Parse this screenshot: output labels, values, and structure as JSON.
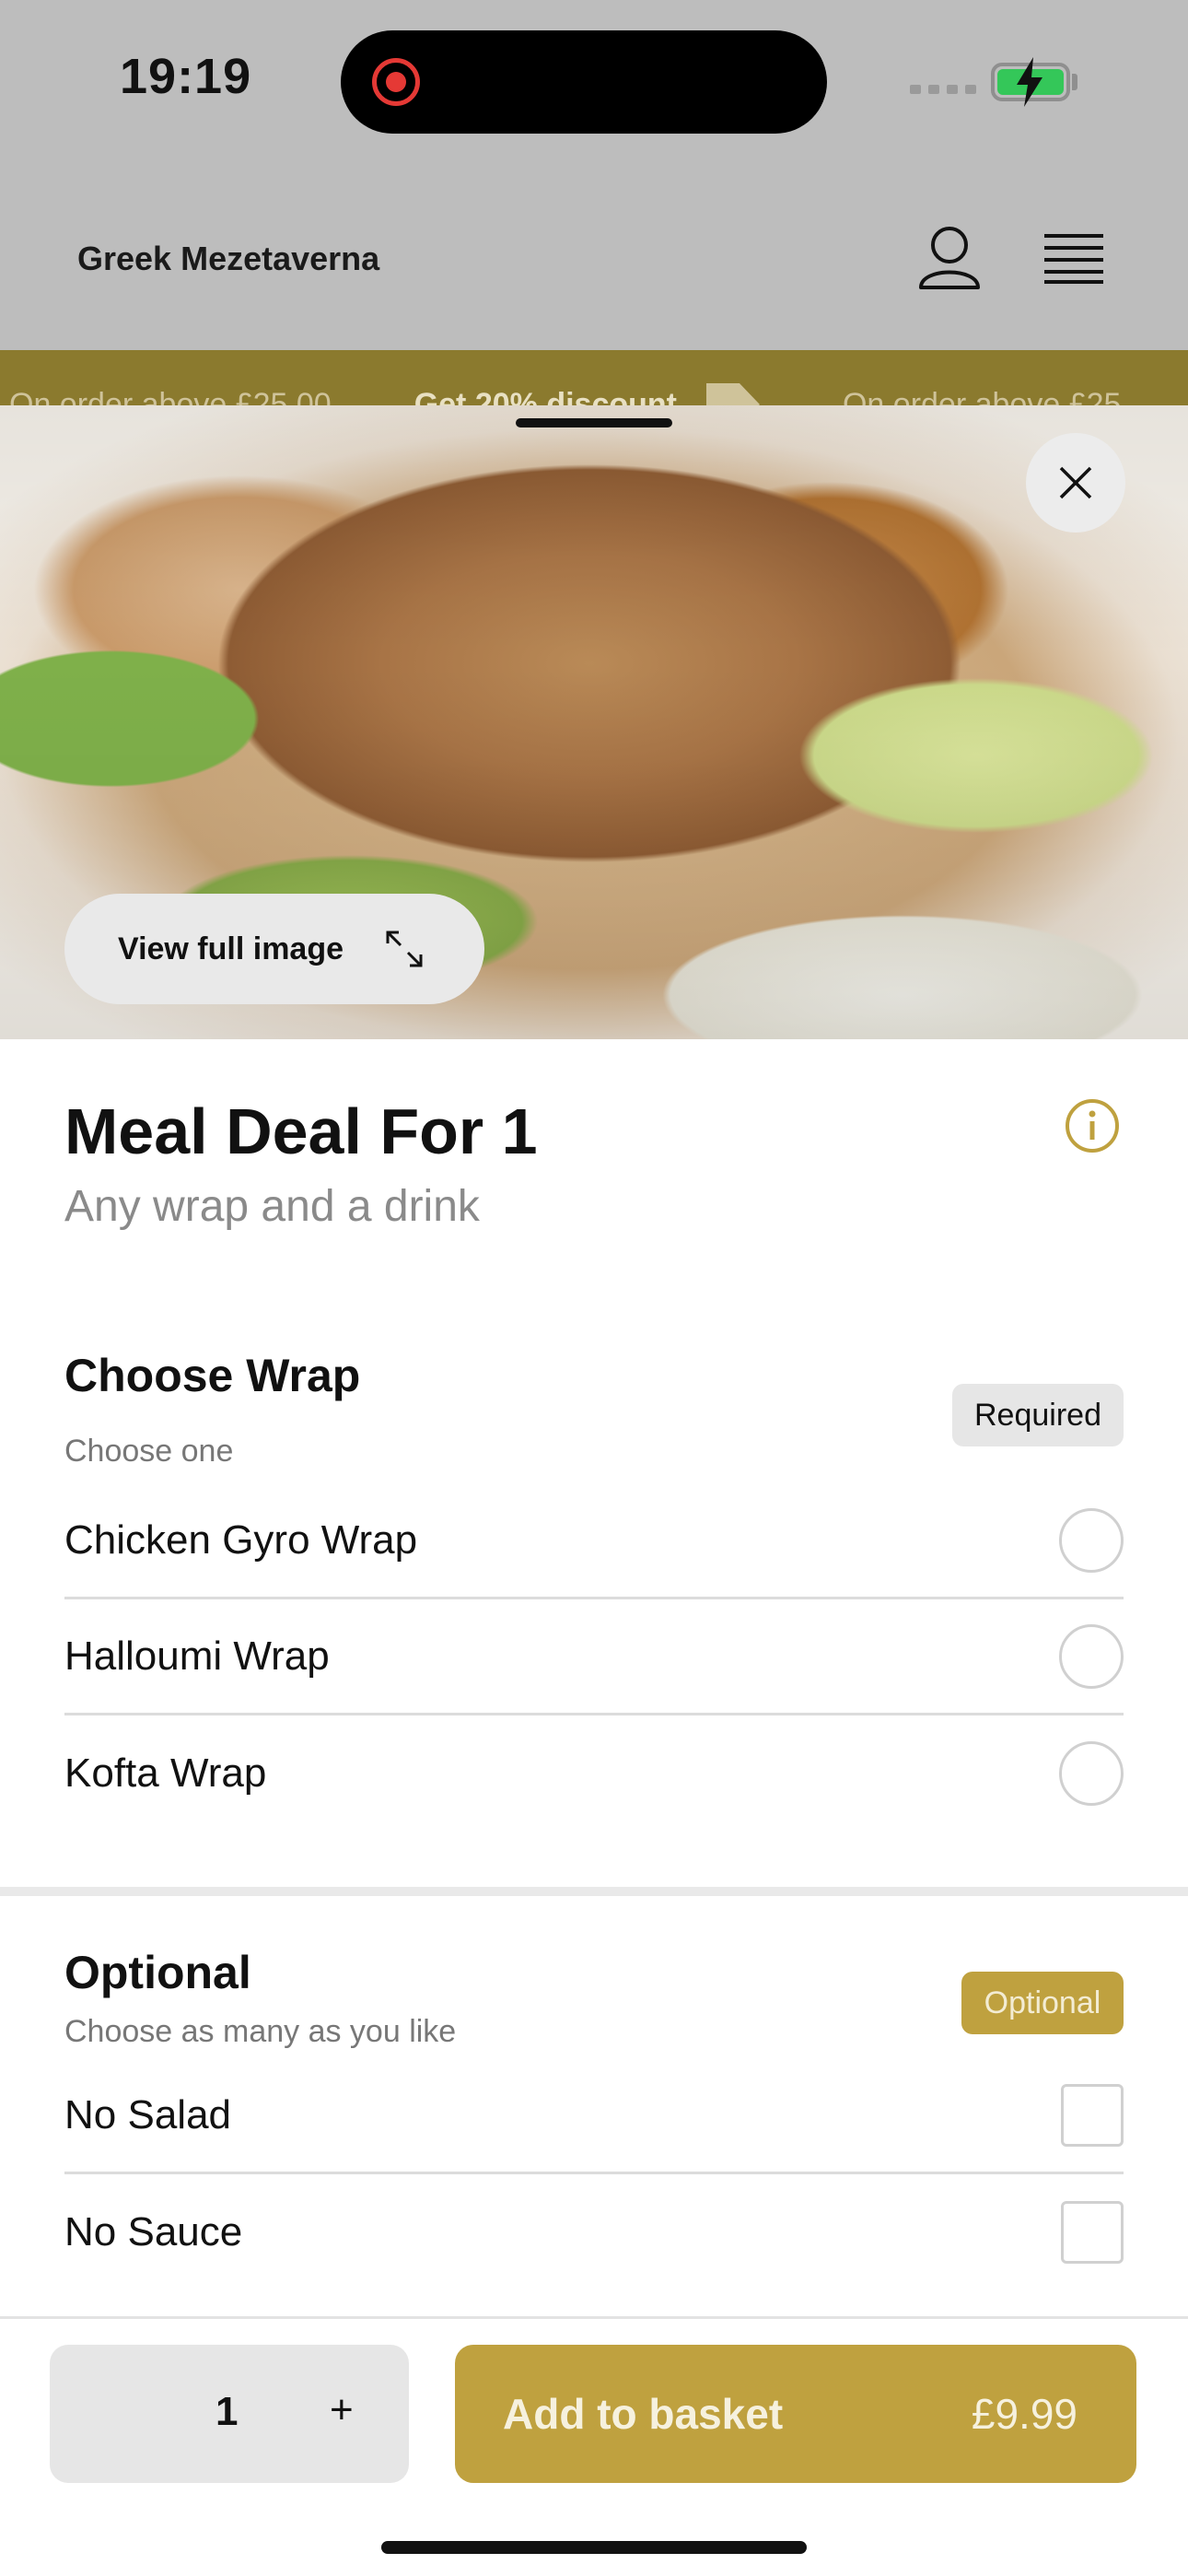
{
  "status_bar": {
    "time": "19:19",
    "icons": [
      "screen-recording-icon",
      "signal-icon",
      "battery-charging-icon"
    ]
  },
  "header": {
    "brand": "Greek Mezetaverna",
    "icons": [
      "user-icon",
      "menu-icon"
    ]
  },
  "promo": {
    "items": [
      "On order above £25.00",
      "Get 20% discount",
      "On order above £25"
    ]
  },
  "item": {
    "view_full_label": "View full image",
    "title": "Meal Deal For 1",
    "subtitle": "Any wrap and a drink"
  },
  "groups": [
    {
      "title": "Choose Wrap",
      "hint": "Choose one",
      "badge": "Required",
      "options": [
        "Chicken Gyro Wrap",
        "Halloumi Wrap",
        "Kofta Wrap"
      ]
    },
    {
      "title": "Optional",
      "hint": "Choose as many as you like",
      "badge": "Optional",
      "options": [
        "No Salad",
        "No Sauce"
      ]
    }
  ],
  "footer": {
    "quantity": "1",
    "plus": "+",
    "add_label": "Add to basket",
    "price": "£9.99"
  },
  "colors": {
    "accent": "#bfa13f",
    "promo_bg": "#8b7a2e",
    "header_bg": "#bdbdbd",
    "battery": "#34c759",
    "recording": "#e53935"
  }
}
